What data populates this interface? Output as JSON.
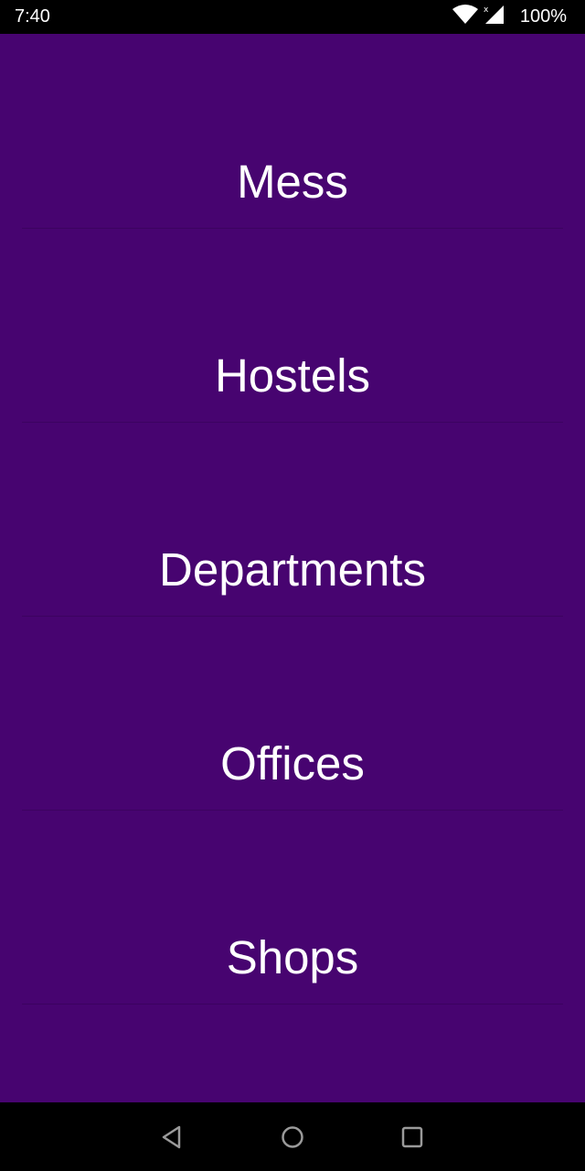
{
  "status_bar": {
    "time": "7:40",
    "battery": "100%",
    "icons": [
      "wifi-icon",
      "signal-icon"
    ]
  },
  "menu": {
    "items": [
      {
        "label": "Mess"
      },
      {
        "label": "Hostels"
      },
      {
        "label": "Departments"
      },
      {
        "label": "Offices"
      },
      {
        "label": "Shops"
      }
    ]
  },
  "nav_bar": {
    "icons": [
      "back-icon",
      "home-icon",
      "recents-icon"
    ]
  },
  "colors": {
    "background": "#470470",
    "text": "#ffffff",
    "divider": "#3c0360",
    "system_bars": "#000000"
  }
}
